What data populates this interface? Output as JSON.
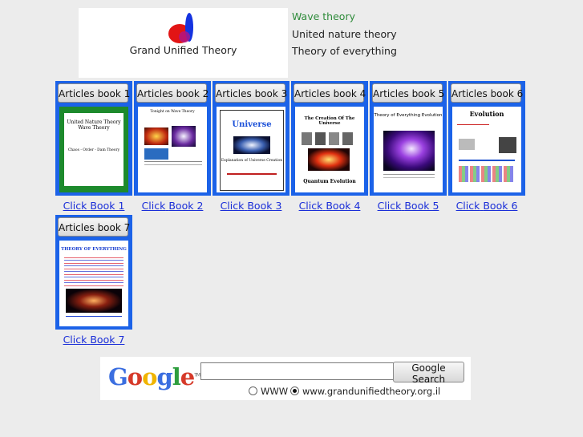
{
  "site": {
    "title": "Grand Unified Theory"
  },
  "nav": [
    {
      "label": "Wave theory",
      "color": "#2e8b3a"
    },
    {
      "label": "United nature theory",
      "color": "#222222"
    },
    {
      "label": "Theory of everything",
      "color": "#222222"
    }
  ],
  "books": [
    {
      "button": "Articles book 1",
      "link_word1": "Click",
      "link_word2": "Book 1",
      "cover_title": "United Nature Theory Wave Theory",
      "cover_sub": "Chaos - Order - Dam Theory",
      "frame_color": "#1d8a2c"
    },
    {
      "button": "Articles book 2",
      "link_word1": "Click",
      "link_word2": "Book 2",
      "cover_title": "Tonight on Wave Theory",
      "cover_sub": "",
      "frame_color": "#ffffff"
    },
    {
      "button": "Articles book 3",
      "link_word1": "Click",
      "link_word2": "Book 3",
      "cover_title": "Universe",
      "cover_sub": "Explanation of Universe Creation",
      "frame_color": "#ffffff"
    },
    {
      "button": "Articles book 4",
      "link_word1": "Click",
      "link_word2": "Book 4",
      "cover_title": "The Creation Of The Universe",
      "cover_sub": "Quantum Evolution",
      "frame_color": "#ffffff"
    },
    {
      "button": "Articles book 5",
      "link_word1": "Click",
      "link_word2": "Book 5",
      "cover_title": "Theory of Everything Evolution",
      "cover_sub": "",
      "frame_color": "#ffffff"
    },
    {
      "button": "Articles book 6",
      "link_word1": "Click",
      "link_word2": "Book 6",
      "cover_title": "Evolution",
      "cover_sub": "",
      "frame_color": "#ffffff"
    },
    {
      "button": "Articles book 7",
      "link_word1": "Click",
      "link_word2": "Book 7",
      "cover_title": "THEORY OF EVERYTHING",
      "cover_sub": "",
      "frame_color": "#ffffff"
    }
  ],
  "search": {
    "brand": "Google",
    "input_value": "",
    "button_label": "Google Search",
    "option_www": "WWW",
    "option_site": "www.grandunifiedtheory.org.il",
    "selected": "site"
  },
  "colors": {
    "accent": "#1b62e8",
    "link": "#1a2ed8",
    "page_bg": "#ececec"
  }
}
